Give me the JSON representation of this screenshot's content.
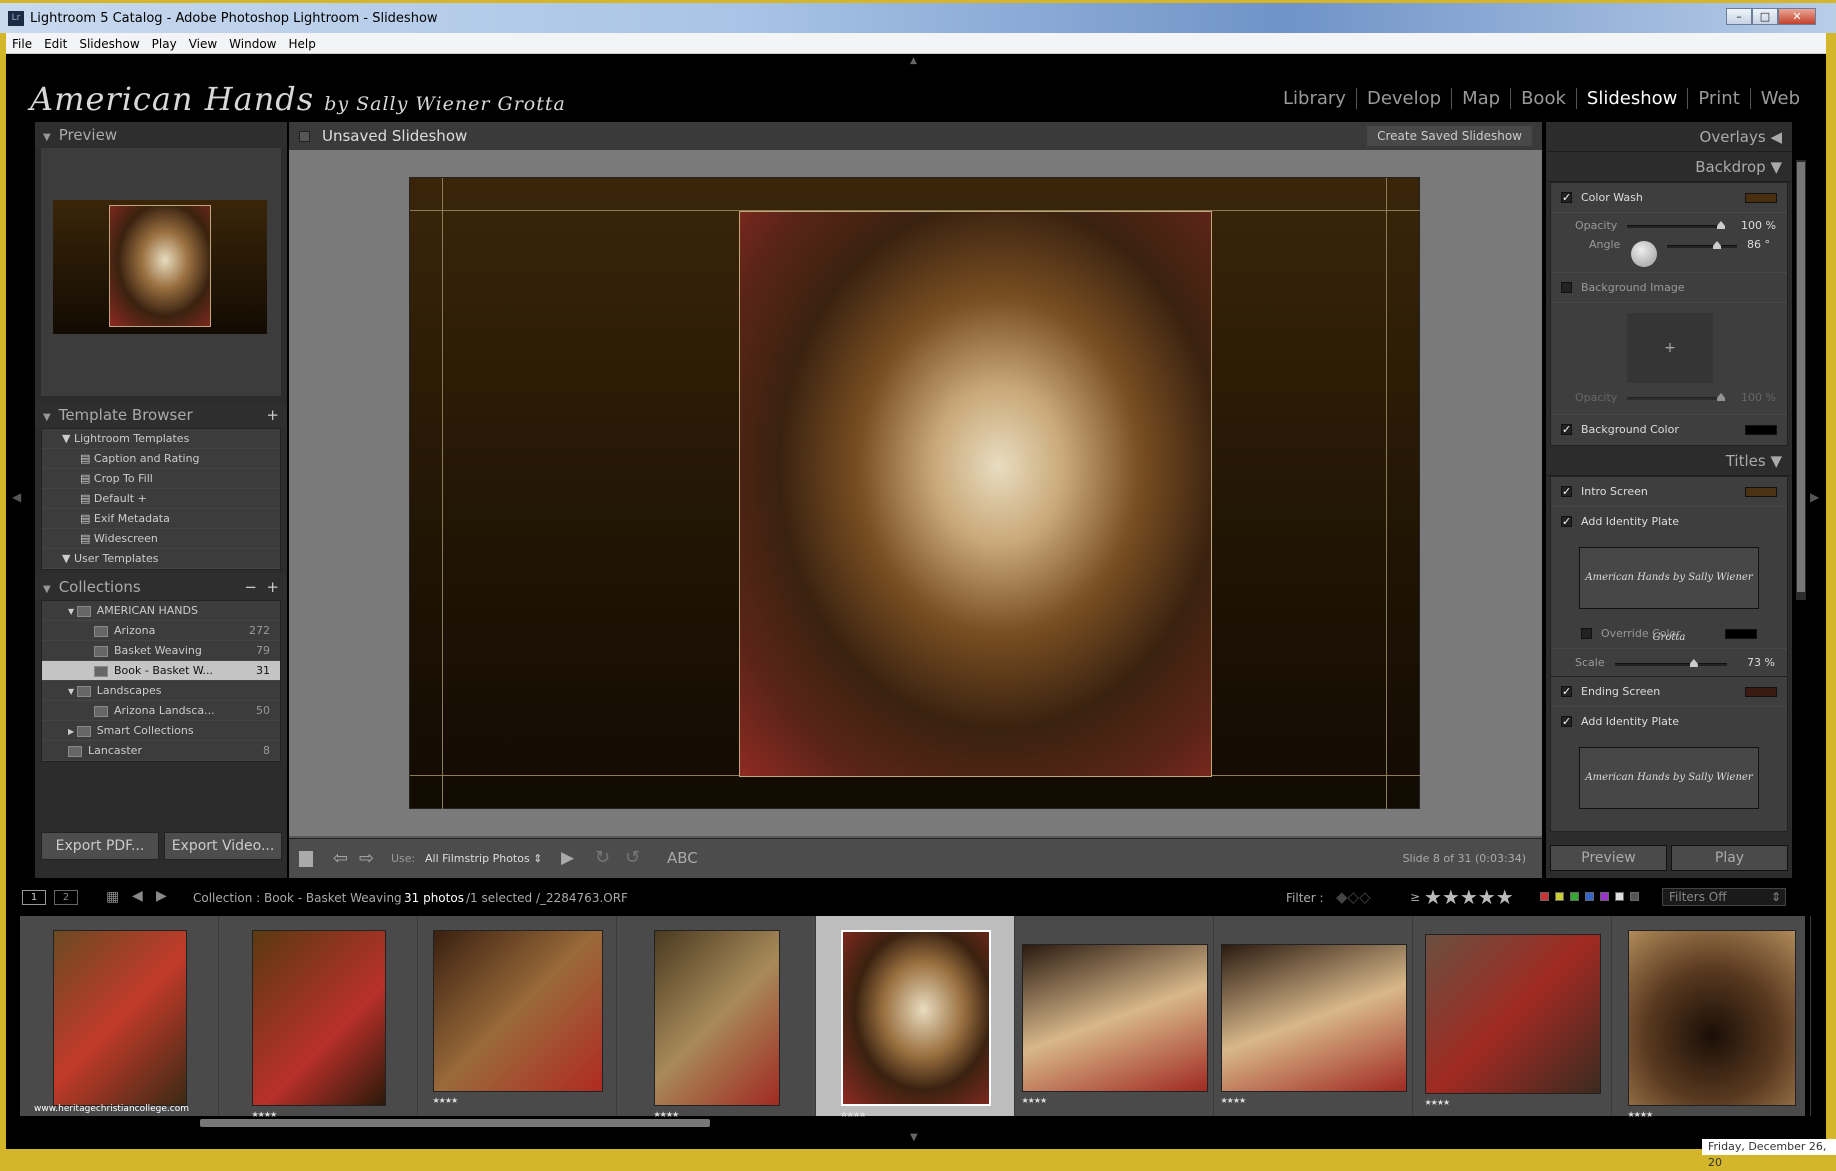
{
  "window": {
    "title": "Lightroom 5 Catalog - Adobe Photoshop Lightroom - Slideshow",
    "app_icon": "Lr"
  },
  "menu": [
    "File",
    "Edit",
    "Slideshow",
    "Play",
    "View",
    "Window",
    "Help"
  ],
  "identity": {
    "main": "American Hands",
    "by": "by Sally Wiener Grotta"
  },
  "modules": [
    {
      "label": "Library"
    },
    {
      "label": "Develop"
    },
    {
      "label": "Map"
    },
    {
      "label": "Book"
    },
    {
      "label": "Slideshow",
      "active": true
    },
    {
      "label": "Print"
    },
    {
      "label": "Web"
    }
  ],
  "left": {
    "preview_title": "Preview",
    "template_browser": {
      "title": "Template Browser",
      "groups": [
        {
          "label": "Lightroom Templates",
          "items": [
            "Caption and Rating",
            "Crop To Fill",
            "Default +",
            "Exif Metadata",
            "Widescreen"
          ]
        },
        {
          "label": "User Templates"
        }
      ]
    },
    "collections": {
      "title": "Collections",
      "items": [
        {
          "label": "AMERICAN HANDS",
          "count": "",
          "level": 1,
          "set": true
        },
        {
          "label": "Arizona",
          "count": "272",
          "level": 2
        },
        {
          "label": "Basket Weaving",
          "count": "79",
          "level": 2
        },
        {
          "label": "Book - Basket W...",
          "count": "31",
          "level": 2,
          "selected": true
        },
        {
          "label": "Landscapes",
          "count": "",
          "level": 1,
          "set": true
        },
        {
          "label": "Arizona Landsca...",
          "count": "50",
          "level": 2
        },
        {
          "label": "Smart Collections",
          "count": "",
          "level": 1,
          "set": true
        },
        {
          "label": "Lancaster",
          "count": "8",
          "level": 1
        }
      ]
    },
    "export_pdf": "Export PDF...",
    "export_video": "Export Video..."
  },
  "center": {
    "title": "Unsaved Slideshow",
    "create_saved": "Create Saved Slideshow",
    "toolbar": {
      "use_label": "Use:",
      "use_value": "All Filmstrip Photos",
      "abc": "ABC",
      "slide_info": "Slide 8 of 31 (0:03:34)"
    }
  },
  "right": {
    "overlays": "Overlays",
    "backdrop": "Backdrop",
    "titles": "Titles",
    "color_wash": {
      "label": "Color Wash",
      "checked": true,
      "color": "#4a2e10",
      "opacity_label": "Opacity",
      "opacity": "100",
      "opacity_unit": "%",
      "angle_label": "Angle",
      "angle": "86",
      "angle_unit": "°"
    },
    "background_image": {
      "label": "Background Image",
      "checked": false,
      "opacity_label": "Opacity",
      "opacity": "100",
      "opacity_unit": "%"
    },
    "background_color": {
      "label": "Background Color",
      "checked": true,
      "color": "#000000"
    },
    "intro_screen": {
      "label": "Intro Screen",
      "checked": true,
      "color": "#4a3212"
    },
    "add_identity_plate": "Add Identity Plate",
    "plate_text": "American Hands by Sally Wiener Grotta",
    "override_color": {
      "label": "Override Color",
      "checked": false,
      "color": "#000000"
    },
    "scale": {
      "label": "Scale",
      "value": "73",
      "unit": "%"
    },
    "ending_screen": {
      "label": "Ending Screen",
      "checked": true,
      "color": "#3a1a12"
    },
    "preview_btn": "Preview",
    "play_btn": "Play"
  },
  "filmstrip_bar": {
    "pages": [
      "1",
      "2"
    ],
    "collection": "Collection : Book - Basket Weaving",
    "count": "31 photos",
    "selection": "/1 selected /_2284763.ORF",
    "filter_label": "Filter :",
    "rating_op": "≥",
    "filters": "Filters Off"
  },
  "filmstrip": {
    "watermark": "www.heritagechristiancollege.com",
    "selected_index": 4,
    "thumbs": [
      {
        "stars": "★★★★"
      },
      {
        "stars": "★★★★"
      },
      {
        "stars": "★★★★"
      },
      {
        "stars": "★★★★"
      },
      {
        "stars": "★★★★"
      },
      {
        "stars": "★★★★"
      },
      {
        "stars": "★★★★"
      },
      {
        "stars": "★★★★"
      },
      {
        "stars": "★★★★"
      }
    ]
  },
  "taskbar": {
    "date": "Friday, December 26, 20"
  }
}
